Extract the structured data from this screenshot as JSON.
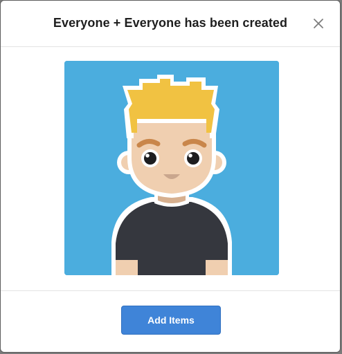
{
  "dialog": {
    "title": "Everyone + Everyone has been created",
    "close_icon": "close-icon",
    "primary_button_label": "Add Items"
  },
  "avatar": {
    "icon": "user-avatar-illustration",
    "background_color": "#4badde",
    "hair_color": "#f1c242",
    "skin_color": "#f0cfb0",
    "shirt_color": "#35373e"
  },
  "colors": {
    "accent": "#3f84d8"
  }
}
